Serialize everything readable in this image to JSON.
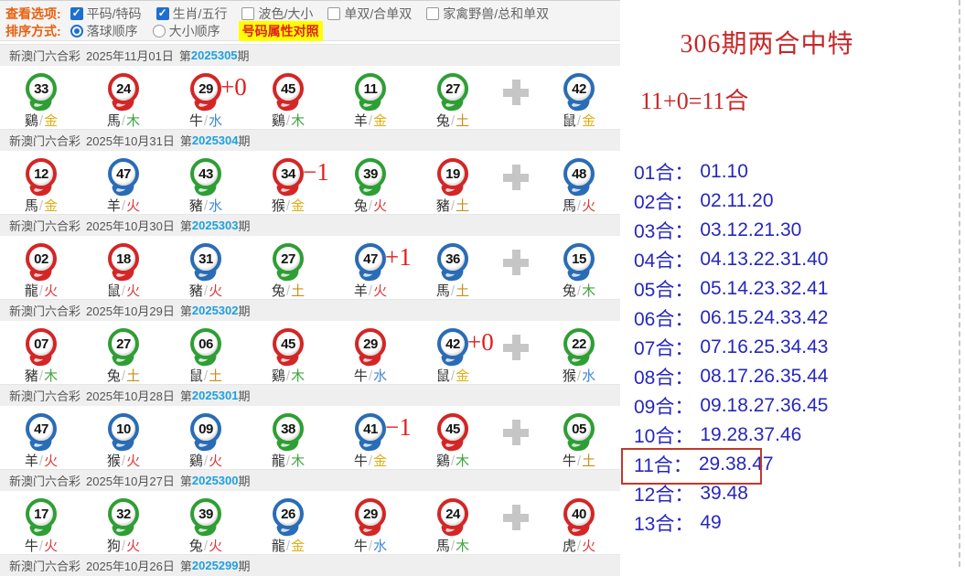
{
  "page": {
    "lottery_name": "新澳门六合彩",
    "period_prefix": "第",
    "period_suffix": "期",
    "separator": "/",
    "colon": "："
  },
  "toolbar": {
    "view_options_label": "查看选项:",
    "view_options": [
      {
        "label": "平码/特码",
        "checked": true
      },
      {
        "label": "生肖/五行",
        "checked": true
      },
      {
        "label": "波色/大小",
        "checked": false
      },
      {
        "label": "单双/合单双",
        "checked": false
      },
      {
        "label": "家禽野兽/总和单双",
        "checked": false
      }
    ],
    "sort_label": "排序方式:",
    "sort_options": [
      {
        "label": "落球顺序",
        "selected": true
      },
      {
        "label": "大小顺序",
        "selected": false
      }
    ],
    "compare_button": "号码属性对照"
  },
  "draws": [
    {
      "date": "2025年11月01日",
      "period": "2025305",
      "annotation": {
        "text": "+0",
        "after_ball": "29"
      },
      "balls": [
        {
          "num": "33",
          "color": "green",
          "zodiac": "鷄",
          "element": "金"
        },
        {
          "num": "24",
          "color": "red",
          "zodiac": "馬",
          "element": "木"
        },
        {
          "num": "29",
          "color": "red",
          "zodiac": "牛",
          "element": "水"
        },
        {
          "num": "45",
          "color": "red",
          "zodiac": "鷄",
          "element": "木"
        },
        {
          "num": "11",
          "color": "green",
          "zodiac": "羊",
          "element": "金"
        },
        {
          "num": "27",
          "color": "green",
          "zodiac": "兔",
          "element": "土"
        },
        {
          "num": "42",
          "color": "blue",
          "zodiac": "鼠",
          "element": "金"
        }
      ]
    },
    {
      "date": "2025年10月31日",
      "period": "2025304",
      "annotation": {
        "text": "−1",
        "after_ball": "34"
      },
      "balls": [
        {
          "num": "12",
          "color": "red",
          "zodiac": "馬",
          "element": "金"
        },
        {
          "num": "47",
          "color": "blue",
          "zodiac": "羊",
          "element": "火"
        },
        {
          "num": "43",
          "color": "green",
          "zodiac": "豬",
          "element": "水"
        },
        {
          "num": "34",
          "color": "red",
          "zodiac": "猴",
          "element": "金"
        },
        {
          "num": "39",
          "color": "green",
          "zodiac": "兔",
          "element": "火"
        },
        {
          "num": "19",
          "color": "red",
          "zodiac": "豬",
          "element": "土"
        },
        {
          "num": "48",
          "color": "blue",
          "zodiac": "馬",
          "element": "火"
        }
      ]
    },
    {
      "date": "2025年10月30日",
      "period": "2025303",
      "annotation": {
        "text": "+1",
        "after_ball": "47"
      },
      "balls": [
        {
          "num": "02",
          "color": "red",
          "zodiac": "龍",
          "element": "火"
        },
        {
          "num": "18",
          "color": "red",
          "zodiac": "鼠",
          "element": "火"
        },
        {
          "num": "31",
          "color": "blue",
          "zodiac": "豬",
          "element": "火"
        },
        {
          "num": "27",
          "color": "green",
          "zodiac": "兔",
          "element": "土"
        },
        {
          "num": "47",
          "color": "blue",
          "zodiac": "羊",
          "element": "火"
        },
        {
          "num": "36",
          "color": "blue",
          "zodiac": "馬",
          "element": "土"
        },
        {
          "num": "15",
          "color": "blue",
          "zodiac": "兔",
          "element": "木"
        }
      ]
    },
    {
      "date": "2025年10月29日",
      "period": "2025302",
      "annotation": {
        "text": "+0",
        "after_ball": "42"
      },
      "balls": [
        {
          "num": "07",
          "color": "red",
          "zodiac": "豬",
          "element": "木"
        },
        {
          "num": "27",
          "color": "green",
          "zodiac": "兔",
          "element": "土"
        },
        {
          "num": "06",
          "color": "green",
          "zodiac": "鼠",
          "element": "土"
        },
        {
          "num": "45",
          "color": "red",
          "zodiac": "鷄",
          "element": "木"
        },
        {
          "num": "29",
          "color": "red",
          "zodiac": "牛",
          "element": "水"
        },
        {
          "num": "42",
          "color": "blue",
          "zodiac": "鼠",
          "element": "金"
        },
        {
          "num": "22",
          "color": "green",
          "zodiac": "猴",
          "element": "水"
        }
      ]
    },
    {
      "date": "2025年10月28日",
      "period": "2025301",
      "annotation": {
        "text": "−1",
        "after_ball": "41"
      },
      "balls": [
        {
          "num": "47",
          "color": "blue",
          "zodiac": "羊",
          "element": "火"
        },
        {
          "num": "10",
          "color": "blue",
          "zodiac": "猴",
          "element": "火"
        },
        {
          "num": "09",
          "color": "blue",
          "zodiac": "鷄",
          "element": "火"
        },
        {
          "num": "38",
          "color": "green",
          "zodiac": "龍",
          "element": "木"
        },
        {
          "num": "41",
          "color": "blue",
          "zodiac": "牛",
          "element": "金"
        },
        {
          "num": "45",
          "color": "red",
          "zodiac": "鷄",
          "element": "木"
        },
        {
          "num": "05",
          "color": "green",
          "zodiac": "牛",
          "element": "土"
        }
      ]
    },
    {
      "date": "2025年10月27日",
      "period": "2025300",
      "balls": [
        {
          "num": "17",
          "color": "green",
          "zodiac": "牛",
          "element": "火"
        },
        {
          "num": "32",
          "color": "green",
          "zodiac": "狗",
          "element": "火"
        },
        {
          "num": "39",
          "color": "green",
          "zodiac": "兔",
          "element": "火"
        },
        {
          "num": "26",
          "color": "blue",
          "zodiac": "龍",
          "element": "金"
        },
        {
          "num": "29",
          "color": "red",
          "zodiac": "牛",
          "element": "水"
        },
        {
          "num": "24",
          "color": "red",
          "zodiac": "馬",
          "element": "木"
        },
        {
          "num": "40",
          "color": "red",
          "zodiac": "虎",
          "element": "火"
        }
      ]
    },
    {
      "date": "2025年10月26日",
      "period": "2025299",
      "balls": []
    }
  ],
  "panel": {
    "title": "306期两合中特",
    "formula": "11+0=11合",
    "highlighted_group": "11合",
    "groups": [
      {
        "label": "01合",
        "value": "01.10"
      },
      {
        "label": "02合",
        "value": "02.11.20"
      },
      {
        "label": "03合",
        "value": "03.12.21.30"
      },
      {
        "label": "04合",
        "value": "04.13.22.31.40"
      },
      {
        "label": "05合",
        "value": "05.14.23.32.41"
      },
      {
        "label": "06合",
        "value": "06.15.24.33.42"
      },
      {
        "label": "07合",
        "value": "07.16.25.34.43"
      },
      {
        "label": "08合",
        "value": "08.17.26.35.44"
      },
      {
        "label": "09合",
        "value": "09.18.27.36.45"
      },
      {
        "label": "10合",
        "value": "19.28.37.46"
      },
      {
        "label": "11合",
        "value": "29.38.47"
      },
      {
        "label": "12合",
        "value": "39.48"
      },
      {
        "label": "13合",
        "value": "49"
      }
    ]
  },
  "colors": {
    "ball_green": "#2f9e35",
    "ball_red": "#d32626",
    "ball_blue": "#2a6cb5",
    "element_gold": "#dfae13",
    "element_wood": "#41a541",
    "element_water": "#3f87d6",
    "element_fire": "#dd3b3b",
    "element_earth": "#c8901a",
    "period_blue": "#1fa0dd",
    "panel_red": "#c62828",
    "panel_blue": "#2727bc",
    "highlight_box": "#c0392b",
    "button_yellow": "#ffff00",
    "label_orange": "#e8600f"
  }
}
